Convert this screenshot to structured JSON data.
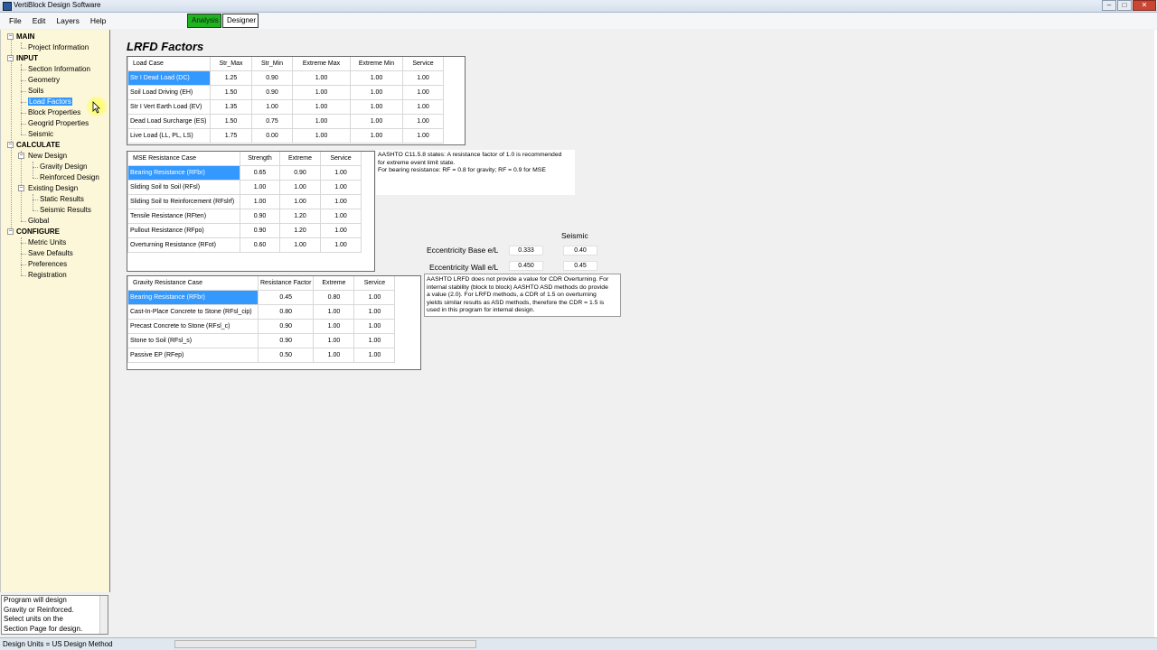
{
  "window": {
    "title": "VertiBlock Design Software",
    "min": "–",
    "max": "□",
    "close": "✕"
  },
  "menu": {
    "file": "File",
    "edit": "Edit",
    "layers": "Layers",
    "help": "Help"
  },
  "modes": {
    "analysis": "Analysis",
    "designer": "Designer",
    "analysis_color": "#1eb41e"
  },
  "tree": {
    "main": "MAIN",
    "project_information": "Project Information",
    "input": "INPUT",
    "section_information": "Section Information",
    "geometry": "Geometry",
    "soils": "Soils",
    "load_factors": "Load Factors",
    "block_properties": "Block Properties",
    "geogrid_properties": "Geogrid Properties",
    "seismic": "Seismic",
    "calculate": "CALCULATE",
    "new_design": "New Design",
    "gravity_design": "Gravity Design",
    "reinforced_design": "Reinforced Design",
    "existing_design": "Existing Design",
    "static_results": "Static Results",
    "seismic_results": "Seismic Results",
    "global": "Global",
    "configure": "CONFIGURE",
    "metric_units": "Metric Units",
    "save_defaults": "Save Defaults",
    "preferences": "Preferences",
    "registration": "Registration"
  },
  "infobox": {
    "line1": "Program will design",
    "line2": "Gravity or Reinforced.",
    "line3": "Select units on the",
    "line4": "Section Page for design."
  },
  "status": {
    "text": "Design Units = US  Design Method"
  },
  "page": {
    "title": "LRFD Factors"
  },
  "load_table": {
    "headers": [
      "Load Case",
      "Str_Max",
      "Str_Min",
      "Extreme Max",
      "Extreme Min",
      "Service"
    ],
    "rows": [
      [
        "Str I Dead Load (DC)",
        "1.25",
        "0.90",
        "1.00",
        "1.00",
        "1.00"
      ],
      [
        "Soil Load Driving (EH)",
        "1.50",
        "0.90",
        "1.00",
        "1.00",
        "1.00"
      ],
      [
        "Str I Vert Earth Load (EV)",
        "1.35",
        "1.00",
        "1.00",
        "1.00",
        "1.00"
      ],
      [
        "Dead Load Surcharge (ES)",
        "1.50",
        "0.75",
        "1.00",
        "1.00",
        "1.00"
      ],
      [
        "Live Load (LL, PL, LS)",
        "1.75",
        "0.00",
        "1.00",
        "1.00",
        "1.00"
      ]
    ]
  },
  "mse_table": {
    "headers": [
      "MSE Resistance Case",
      "Strength",
      "Extreme",
      "Service"
    ],
    "rows": [
      [
        "Bearing Resistance (RFbr)",
        "0.65",
        "0.90",
        "1.00"
      ],
      [
        "Sliding Soil to Soil (RFsl)",
        "1.00",
        "1.00",
        "1.00"
      ],
      [
        "Sliding Soil to Reinforcement (RFslrf)",
        "1.00",
        "1.00",
        "1.00"
      ],
      [
        "Tensile Resistance (RFten)",
        "0.90",
        "1.20",
        "1.00"
      ],
      [
        "Pullout Resistance (RFpo)",
        "0.90",
        "1.20",
        "1.00"
      ],
      [
        "Overturning Resistance (RFot)",
        "0.60",
        "1.00",
        "1.00"
      ]
    ]
  },
  "gravity_table": {
    "headers": [
      "Gravity Resistance Case",
      "Resistance Factor",
      "Extreme",
      "Service"
    ],
    "rows": [
      [
        "Bearing Resistance (RFbr)",
        "0.45",
        "0.80",
        "1.00"
      ],
      [
        "Cast-In-Place Concrete to Stone (RFsl_cip)",
        "0.80",
        "1.00",
        "1.00"
      ],
      [
        "Precast Concrete to Stone (RFsl_c)",
        "0.90",
        "1.00",
        "1.00"
      ],
      [
        "Stone to Soil (RFsl_s)",
        "0.90",
        "1.00",
        "1.00"
      ],
      [
        "Passive EP (RFep)",
        "0.50",
        "1.00",
        "1.00"
      ]
    ]
  },
  "aashto_note": {
    "line1": "AASHTO C11.5.8 states: A resistance factor of 1.0 is recommended",
    "line2": "for extreme event limit state.",
    "line3": "For bearing resistance: RF = 0.8 for gravity; RF = 0.9 for MSE"
  },
  "eccentricity": {
    "seismic_label": "Seismic",
    "base_label": "Eccentricity Base e/L",
    "base_value": "0.333",
    "base_seismic": "0.40",
    "wall_label": "Eccentricity Wall e/L",
    "wall_value": "0.450",
    "wall_seismic": "0.45"
  },
  "cdr_note": {
    "line1": "AASHTO LRFD does not provide a value for CDR Overturning.  For",
    "line2": "internal stability (block to block) AASHTO ASD methods do provide",
    "line3": "a value (2.0).  For LRFD methods, a CDR of 1.5 on overturning",
    "line4": "yields similar results as ASD methods, therefore the CDR = 1.5 is",
    "line5": "used in this program for internal design."
  },
  "colors": {
    "selection": "#3399ff",
    "sidebar_bg": "#fcf7d8"
  }
}
